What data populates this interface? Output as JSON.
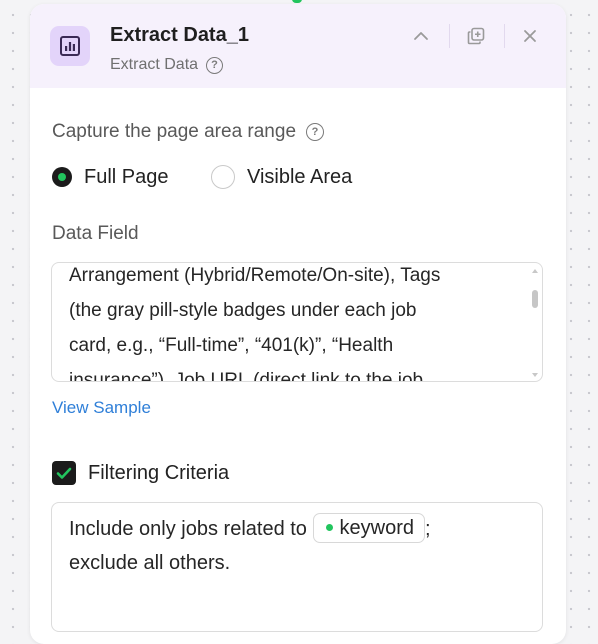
{
  "header": {
    "title": "Extract Data_1",
    "subtitle": "Extract Data",
    "icon": "bar-chart-icon",
    "actions": [
      "chevron-up-icon",
      "duplicate-icon",
      "close-icon"
    ]
  },
  "capture": {
    "label": "Capture the page area range",
    "options": [
      {
        "label": "Full Page",
        "selected": true
      },
      {
        "label": "Visible Area",
        "selected": false
      }
    ]
  },
  "data_field": {
    "label": "Data Field",
    "lines": [
      "Arrangement (Hybrid/Remote/On-site), Tags",
      "(the gray pill-style badges under each job",
      "card, e.g., “Full-time”, “401(k)”, “Health",
      "insurance”), Job URL (direct link to the job"
    ]
  },
  "view_sample": "View Sample",
  "filtering": {
    "label": "Filtering Criteria",
    "checked": true,
    "text_before": "Include only jobs related to",
    "chip": "keyword",
    "text_after": ";",
    "line2": "exclude all others."
  },
  "colors": {
    "accent_green": "#22c55e",
    "header_bg": "#f6f1fc",
    "link_blue": "#2f7fd8"
  }
}
